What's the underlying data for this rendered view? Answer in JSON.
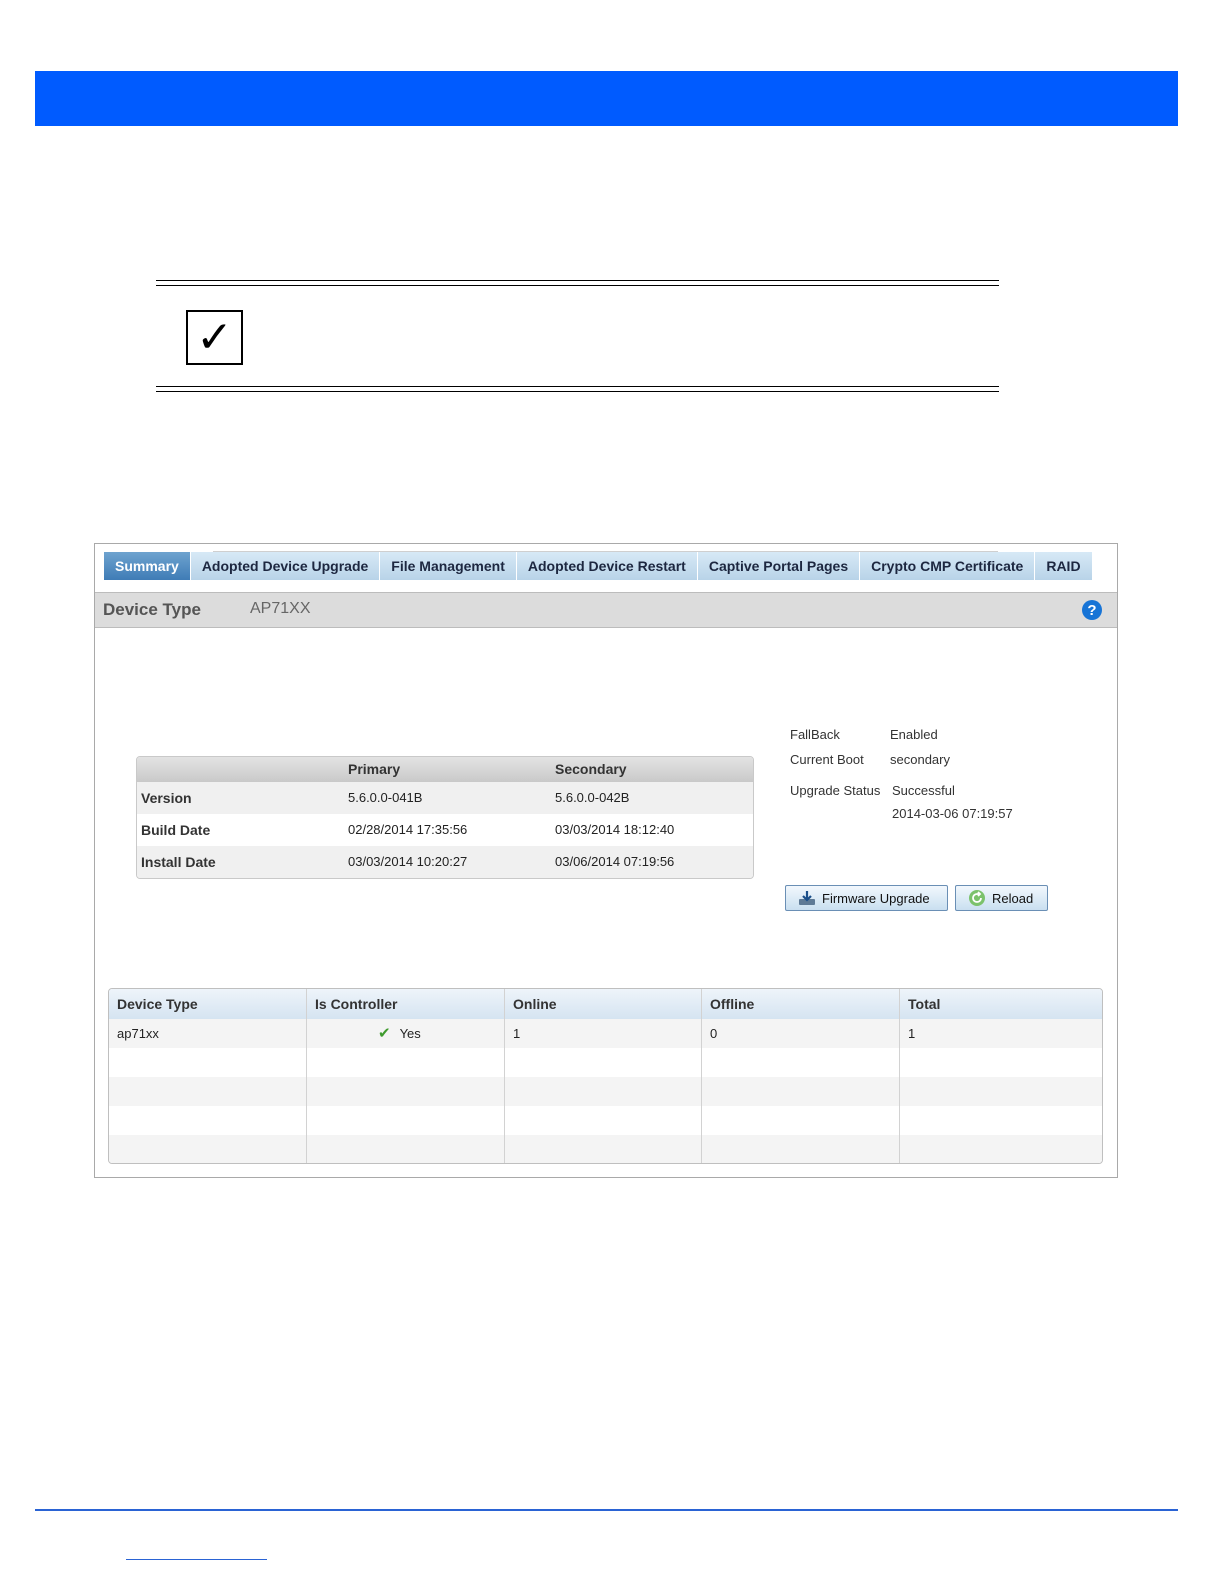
{
  "note": {
    "icon": "checkbox-check-icon",
    "glyph": "✓"
  },
  "tabs": [
    {
      "label": "Summary",
      "active": true
    },
    {
      "label": "Adopted Device Upgrade",
      "active": false
    },
    {
      "label": "File Management",
      "active": false
    },
    {
      "label": "Adopted Device Restart",
      "active": false
    },
    {
      "label": "Captive Portal Pages",
      "active": false
    },
    {
      "label": "Crypto CMP Certificate",
      "active": false
    },
    {
      "label": "RAID",
      "active": false
    }
  ],
  "header": {
    "label": "Device Type",
    "value": "AP71XX",
    "help": "?"
  },
  "firmware": {
    "columns": [
      "",
      "Primary",
      "Secondary"
    ],
    "rows": [
      {
        "label": "Version",
        "primary": "5.6.0.0-041B",
        "secondary": "5.6.0.0-042B"
      },
      {
        "label": "Build Date",
        "primary": "02/28/2014 17:35:56",
        "secondary": "03/03/2014 18:12:40"
      },
      {
        "label": "Install Date",
        "primary": "03/03/2014 10:20:27",
        "secondary": "03/06/2014 07:19:56"
      }
    ]
  },
  "status": {
    "fallback_label": "FallBack",
    "fallback_value": "Enabled",
    "current_boot_label": "Current Boot",
    "current_boot_value": "secondary",
    "upgrade_status_label": "Upgrade Status",
    "upgrade_status_value": "Successful",
    "upgrade_time": "2014-03-06 07:19:57"
  },
  "buttons": {
    "firmware_upgrade": "Firmware Upgrade",
    "reload": "Reload"
  },
  "devices": {
    "columns": [
      "Device Type",
      "Is Controller",
      "Online",
      "Offline",
      "Total"
    ],
    "rows": [
      {
        "device_type": "ap71xx",
        "is_controller": "Yes",
        "online": "1",
        "offline": "0",
        "total": "1"
      }
    ]
  },
  "colors": {
    "banner": "#005bff",
    "tab_active": "#3f7cb6",
    "tab_inactive": "#c6ddef",
    "check": "#3f9b2e"
  }
}
